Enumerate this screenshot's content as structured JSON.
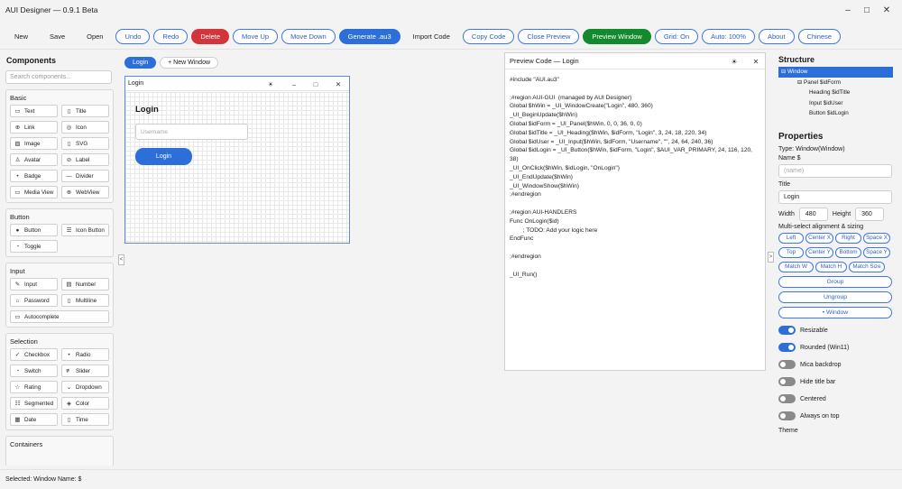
{
  "window": {
    "title": "AUI Designer — 0.9.1 Beta"
  },
  "toolbar": [
    {
      "label": "New",
      "style": "plain"
    },
    {
      "label": "Save",
      "style": "plain"
    },
    {
      "label": "Open",
      "style": "plain"
    },
    {
      "label": "Undo",
      "style": "out"
    },
    {
      "label": "Redo",
      "style": "out"
    },
    {
      "label": "Delete",
      "style": "red"
    },
    {
      "label": "Move Up",
      "style": "out"
    },
    {
      "label": "Move Down",
      "style": "out"
    },
    {
      "label": "Generate .au3",
      "style": "blue"
    },
    {
      "label": "Import Code",
      "style": "plain"
    },
    {
      "label": "Copy Code",
      "style": "out"
    },
    {
      "label": "Close Preview",
      "style": "out"
    },
    {
      "label": "Preview Window",
      "style": "green"
    },
    {
      "label": "Grid: On",
      "style": "out"
    },
    {
      "label": "Auto: 100%",
      "style": "out"
    },
    {
      "label": "About",
      "style": "out"
    },
    {
      "label": "Chinese",
      "style": "out"
    }
  ],
  "components": {
    "title": "Components",
    "search_placeholder": "Search components...",
    "groups": [
      {
        "name": "Basic",
        "items": [
          {
            "label": "Text",
            "icon": "▭"
          },
          {
            "label": "Title",
            "icon": "▯"
          },
          {
            "label": "Link",
            "icon": "⊕"
          },
          {
            "label": "Icon",
            "icon": "◎"
          },
          {
            "label": "Image",
            "icon": "▨"
          },
          {
            "label": "SVG",
            "icon": "▯"
          },
          {
            "label": "Avatar",
            "icon": "♙"
          },
          {
            "label": "Label",
            "icon": "⊘"
          },
          {
            "label": "Badge",
            "icon": "•"
          },
          {
            "label": "Divider",
            "icon": "—"
          },
          {
            "label": "Media View",
            "icon": "▭"
          },
          {
            "label": "WebView",
            "icon": "⊕"
          }
        ]
      },
      {
        "name": "Button",
        "items": [
          {
            "label": "Button",
            "icon": "●"
          },
          {
            "label": "Icon Button",
            "icon": "☰"
          },
          {
            "label": "Toggle",
            "icon": "◔"
          }
        ]
      },
      {
        "name": "Input",
        "items": [
          {
            "label": "Input",
            "icon": "✎"
          },
          {
            "label": "Number",
            "icon": "▤"
          },
          {
            "label": "Password",
            "icon": "⌂"
          },
          {
            "label": "Multiline",
            "icon": "▯"
          },
          {
            "label": "Autocomplete",
            "icon": "▭",
            "wide": true
          }
        ]
      },
      {
        "name": "Selection",
        "items": [
          {
            "label": "Checkbox",
            "icon": "✓"
          },
          {
            "label": "Radio",
            "icon": "•"
          },
          {
            "label": "Switch",
            "icon": "◔"
          },
          {
            "label": "Slider",
            "icon": "≢"
          },
          {
            "label": "Rating",
            "icon": "☆"
          },
          {
            "label": "Dropdown",
            "icon": "⌄"
          },
          {
            "label": "Segmented",
            "icon": "☷"
          },
          {
            "label": "Color",
            "icon": "◈"
          },
          {
            "label": "Date",
            "icon": "▦"
          },
          {
            "label": "Time",
            "icon": "▯"
          }
        ]
      },
      {
        "name": "Containers",
        "items": []
      }
    ]
  },
  "canvas": {
    "tabs": [
      {
        "label": "Login",
        "active": true
      },
      {
        "label": "+ New Window",
        "active": false
      }
    ],
    "window": {
      "title": "Login",
      "theme_icon": "☀",
      "minimize": "–",
      "maximize": "□",
      "close": "✕",
      "heading": "Login",
      "input_placeholder": "Username",
      "button_label": "Login"
    },
    "collapse_left": "<",
    "collapse_right": ">"
  },
  "preview": {
    "title": "Preview Code — Login",
    "theme_icon": "☀",
    "close": "✕",
    "code": "#include \"AUI.au3\"\n\n;#region AUI-GUI  (managed by AUI Designer)\nGlobal $hWin = _UI_WindowCreate(\"Login\", 480, 360)\n_UI_BeginUpdate($hWin)\nGlobal $idForm = _UI_Panel($hWin, 0, 0, 36, 0, 0)\nGlobal $idTitle = _UI_Heading($hWin, $idForm, \"Login\", 3, 24, 18, 220, 34)\nGlobal $idUser = _UI_Input($hWin, $idForm, \"Username\", \"\", 24, 64, 240, 36)\nGlobal $idLogin = _UI_Button($hWin, $idForm, \"Login\", $AUI_VAR_PRIMARY, 24, 116, 120, 38)\n_UI_OnClick($hWin, $idLogin, \"OnLogin\")\n_UI_EndUpdate($hWin)\n_UI_WindowShow($hWin)\n;#endregion\n\n;#region AUI-HANDLERS\nFunc OnLogin($id)\n        ; TODO: Add your logic here\nEndFunc\n\n;#endregion\n\n_UI_Run()"
  },
  "structure": {
    "title": "Structure",
    "nodes": [
      {
        "label": "⊟ Window",
        "indent": 0,
        "selected": true
      },
      {
        "label": "⊟ Panel  $idForm",
        "indent": 1,
        "selected": false
      },
      {
        "label": "Heading  $idTitle",
        "indent": 2,
        "selected": false
      },
      {
        "label": "Input  $idUser",
        "indent": 2,
        "selected": false
      },
      {
        "label": "Button  $idLogin",
        "indent": 2,
        "selected": false
      }
    ]
  },
  "properties": {
    "title": "Properties",
    "type_line": "Type: Window(Window)",
    "name_label": "Name $",
    "name_placeholder": "(name)",
    "title_label": "Title",
    "title_value": "Login",
    "width_label": "Width",
    "width_value": "480",
    "height_label": "Height",
    "height_value": "360",
    "align_label": "Multi-select alignment & sizing",
    "align_rows": [
      [
        "Left",
        "Center X",
        "Right",
        "Space X"
      ],
      [
        "Top",
        "Center Y",
        "Bottom",
        "Space Y"
      ],
      [
        "Match W",
        "Match H",
        "Match Size"
      ]
    ],
    "group_btn": "Group",
    "ungroup_btn": "Ungroup",
    "window_btn": "• Window",
    "toggles": [
      {
        "label": "Resizable",
        "on": true
      },
      {
        "label": "Rounded (Win11)",
        "on": true
      },
      {
        "label": "Mica backdrop",
        "on": false
      },
      {
        "label": "Hide title bar",
        "on": false
      },
      {
        "label": "Centered",
        "on": false
      },
      {
        "label": "Always on top",
        "on": false
      }
    ],
    "theme_label": "Theme"
  },
  "status": {
    "text": "Selected: Window   Name: $"
  },
  "titlebar_buttons": {
    "minimize": "–",
    "maximize": "□",
    "close": "✕"
  }
}
